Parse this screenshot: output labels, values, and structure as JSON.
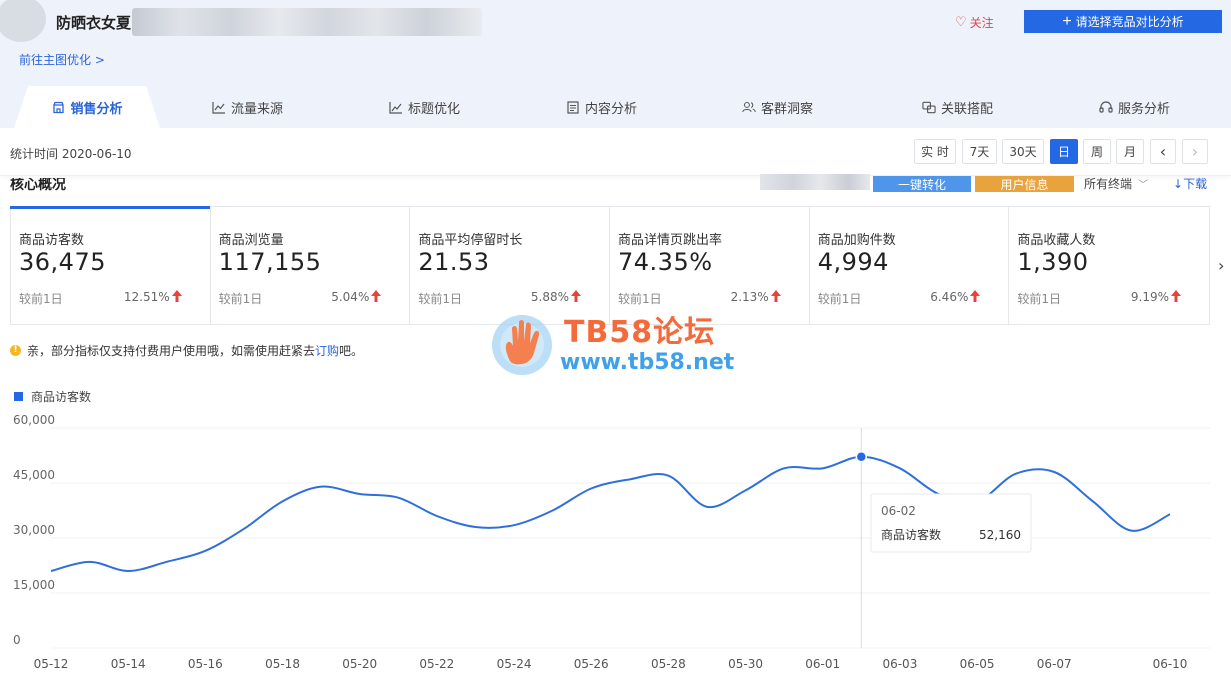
{
  "header": {
    "product_title": "防晒衣女夏",
    "follow_label": "关注",
    "compare_label": "请选择竞品对比分析",
    "goto_link": "前往主图优化 >"
  },
  "tabs": [
    {
      "label": "销售分析",
      "icon": "store-icon",
      "active": true
    },
    {
      "label": "流量来源",
      "icon": "line-chart-icon",
      "active": false
    },
    {
      "label": "标题优化",
      "icon": "trend-icon",
      "active": false
    },
    {
      "label": "内容分析",
      "icon": "document-icon",
      "active": false
    },
    {
      "label": "客群洞察",
      "icon": "users-icon",
      "active": false
    },
    {
      "label": "关联搭配",
      "icon": "link-icon",
      "active": false
    },
    {
      "label": "服务分析",
      "icon": "headset-icon",
      "active": false
    }
  ],
  "timebar": {
    "stat_date": "统计时间 2020-06-10",
    "buttons": [
      "实 时",
      "7天",
      "30天",
      "日",
      "周",
      "月"
    ],
    "active_button": "日",
    "prev": "‹",
    "next": "›"
  },
  "core": {
    "title": "核心概况",
    "oneclick_label": "一键转化",
    "userinfo_label": "用户信息",
    "devices_label": "所有终端",
    "download_label": "下载"
  },
  "metrics": [
    {
      "label": "商品访客数",
      "value": "36,475",
      "compare": "较前1日",
      "pct": "12.51%",
      "trend": "up"
    },
    {
      "label": "商品浏览量",
      "value": "117,155",
      "compare": "较前1日",
      "pct": "5.04%",
      "trend": "up"
    },
    {
      "label": "商品平均停留时长",
      "value": "21.53",
      "compare": "较前1日",
      "pct": "5.88%",
      "trend": "up"
    },
    {
      "label": "商品详情页跳出率",
      "value": "74.35%",
      "compare": "较前1日",
      "pct": "2.13%",
      "trend": "up"
    },
    {
      "label": "商品加购件数",
      "value": "4,994",
      "compare": "较前1日",
      "pct": "6.46%",
      "trend": "up"
    },
    {
      "label": "商品收藏人数",
      "value": "1,390",
      "compare": "较前1日",
      "pct": "9.19%",
      "trend": "up"
    }
  ],
  "notice": {
    "text_before": "亲，部分指标仅支持付费用户使用哦，如需使用赶紧去",
    "link": "订购",
    "text_after": "吧。"
  },
  "watermark": {
    "line1": "TB58论坛",
    "line2": "www.tb58.net"
  },
  "colors": {
    "accent": "#2468e3",
    "link": "#2c64d8",
    "up_arrow": "#e8433b",
    "line": "#2f6fdc",
    "orange": "#e8a33d"
  },
  "chart_data": {
    "type": "line",
    "legend": "商品访客数",
    "ylim": [
      0,
      60000
    ],
    "yticks": [
      "60,000",
      "45,000",
      "30,000",
      "15,000",
      "0"
    ],
    "ytick_values": [
      60000,
      45000,
      30000,
      15000,
      0
    ],
    "x": [
      "05-12",
      "05-13",
      "05-14",
      "05-15",
      "05-16",
      "05-17",
      "05-18",
      "05-19",
      "05-20",
      "05-21",
      "05-22",
      "05-23",
      "05-24",
      "05-25",
      "05-26",
      "05-27",
      "05-28",
      "05-29",
      "05-30",
      "05-31",
      "06-01",
      "06-02",
      "06-03",
      "06-04",
      "06-05",
      "06-06",
      "06-07",
      "06-08",
      "06-09",
      "06-10"
    ],
    "xtick_labels": [
      "05-12",
      "05-14",
      "05-16",
      "05-18",
      "05-20",
      "05-22",
      "05-24",
      "05-26",
      "05-28",
      "05-30",
      "06-01",
      "06-03",
      "06-05",
      "06-07",
      "06-10"
    ],
    "series": [
      {
        "name": "商品访客数",
        "values": [
          21000,
          23500,
          21000,
          23500,
          26500,
          32500,
          40000,
          44000,
          42000,
          41000,
          36000,
          33000,
          33500,
          37500,
          43500,
          46000,
          47000,
          38500,
          43000,
          49000,
          49000,
          52160,
          49000,
          42000,
          40000,
          47500,
          48000,
          40000,
          32000,
          36475
        ]
      }
    ],
    "tooltip": {
      "date": "06-02",
      "label": "商品访客数",
      "value": "52,160"
    }
  }
}
